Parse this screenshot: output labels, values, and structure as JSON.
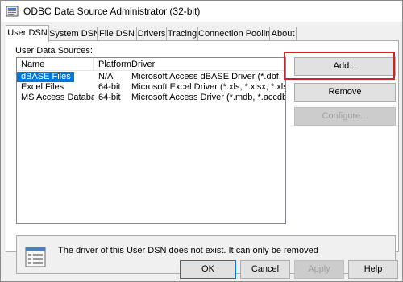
{
  "window": {
    "title": "ODBC Data Source Administrator (32-bit)",
    "icon": "odbc-app-icon"
  },
  "tabs": [
    {
      "label": "User DSN",
      "active": true
    },
    {
      "label": "System DSN"
    },
    {
      "label": "File DSN"
    },
    {
      "label": "Drivers"
    },
    {
      "label": "Tracing"
    },
    {
      "label": "Connection Pooling"
    },
    {
      "label": "About"
    }
  ],
  "panel": {
    "group_label": "User Data Sources:",
    "columns": [
      "Name",
      "Platform",
      "Driver"
    ],
    "rows": [
      {
        "name": "dBASE Files",
        "platform": "N/A",
        "driver": "Microsoft Access dBASE Driver (*.dbf, *.ndx, *.mdx)",
        "selected": true
      },
      {
        "name": "Excel Files",
        "platform": "64-bit",
        "driver": "Microsoft Excel Driver (*.xls, *.xlsx, *.xlsm, *.xlsb)"
      },
      {
        "name": "MS Access Database",
        "platform": "64-bit",
        "driver": "Microsoft Access Driver (*.mdb, *.accdb)"
      }
    ]
  },
  "side_buttons": {
    "add": "Add...",
    "remove": "Remove",
    "configure": "Configure..."
  },
  "info": {
    "icon": "database-list-icon",
    "text": "The driver of this User DSN does not exist. It can only be removed"
  },
  "footer_buttons": {
    "ok": "OK",
    "cancel": "Cancel",
    "apply": "Apply",
    "help": "Help"
  },
  "colors": {
    "selection": "#0078d7",
    "highlight_box": "#d4202a"
  }
}
